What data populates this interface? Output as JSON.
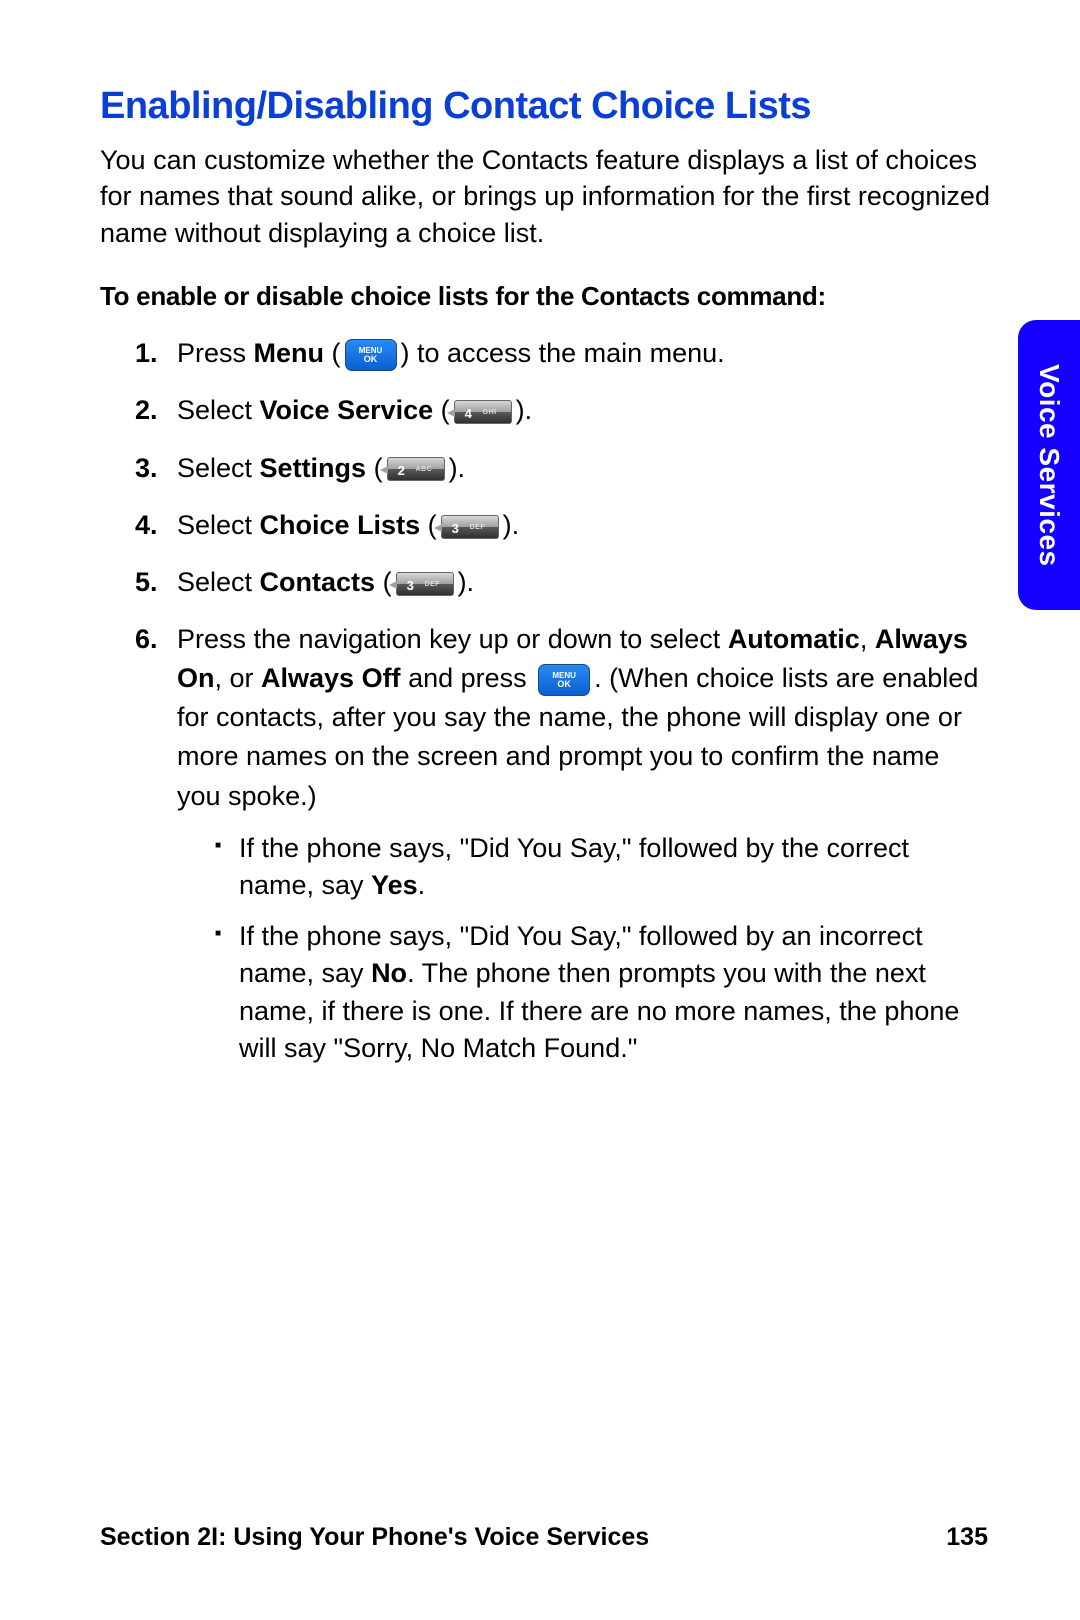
{
  "heading": "Enabling/Disabling Contact Choice Lists",
  "intro": "You can customize whether the Contacts feature displays a list of choices for names that sound alike, or brings up information for the first recognized name without displaying a choice list.",
  "subheading": "To enable or disable choice lists for the Contacts command:",
  "side_tab": "Voice Services",
  "steps": {
    "s1_a": "Press ",
    "s1_b": "Menu",
    "s1_c": " (",
    "s1_d": ") to access the main menu.",
    "s2_a": "Select ",
    "s2_b": "Voice Service",
    "s2_c": " (",
    "s2_d": ").",
    "s3_a": "Select ",
    "s3_b": "Settings",
    "s3_c": " (",
    "s3_d": ").",
    "s4_a": "Select ",
    "s4_b": "Choice Lists",
    "s4_c": " (",
    "s4_d": ").",
    "s5_a": "Select ",
    "s5_b": "Contacts",
    "s5_c": " (",
    "s5_d": ").",
    "s6_a": "Press the navigation key up or down to select ",
    "s6_b": "Automatic",
    "s6_c": ", ",
    "s6_d": "Always On",
    "s6_e": ", or ",
    "s6_f": "Always Off",
    "s6_g": " and press ",
    "s6_h": ". (When choice lists are enabled for contacts, after you say the name, the phone will display one or more names on the screen and prompt you to confirm the name you spoke.)"
  },
  "keys": {
    "menu_label_top": "MENU",
    "menu_label_bottom": "OK",
    "k4_num": "4",
    "k4_letters": "GHI",
    "k2_num": "2",
    "k2_letters": "ABC",
    "k3_num": "3",
    "k3_letters": "DEF"
  },
  "bullets": {
    "b1_a": "If the phone says, \"Did You Say,\" followed by the correct name, say ",
    "b1_b": "Yes",
    "b1_c": ".",
    "b2_a": "If the phone says, \"Did You Say,\" followed by an incorrect name, say ",
    "b2_b": "No",
    "b2_c": ". The phone then prompts you with the next name, if there is one. If there are no more names, the phone will say \"Sorry, No Match Found.\""
  },
  "footer": {
    "section": "Section 2I: Using Your Phone's Voice Services",
    "page": "135"
  }
}
